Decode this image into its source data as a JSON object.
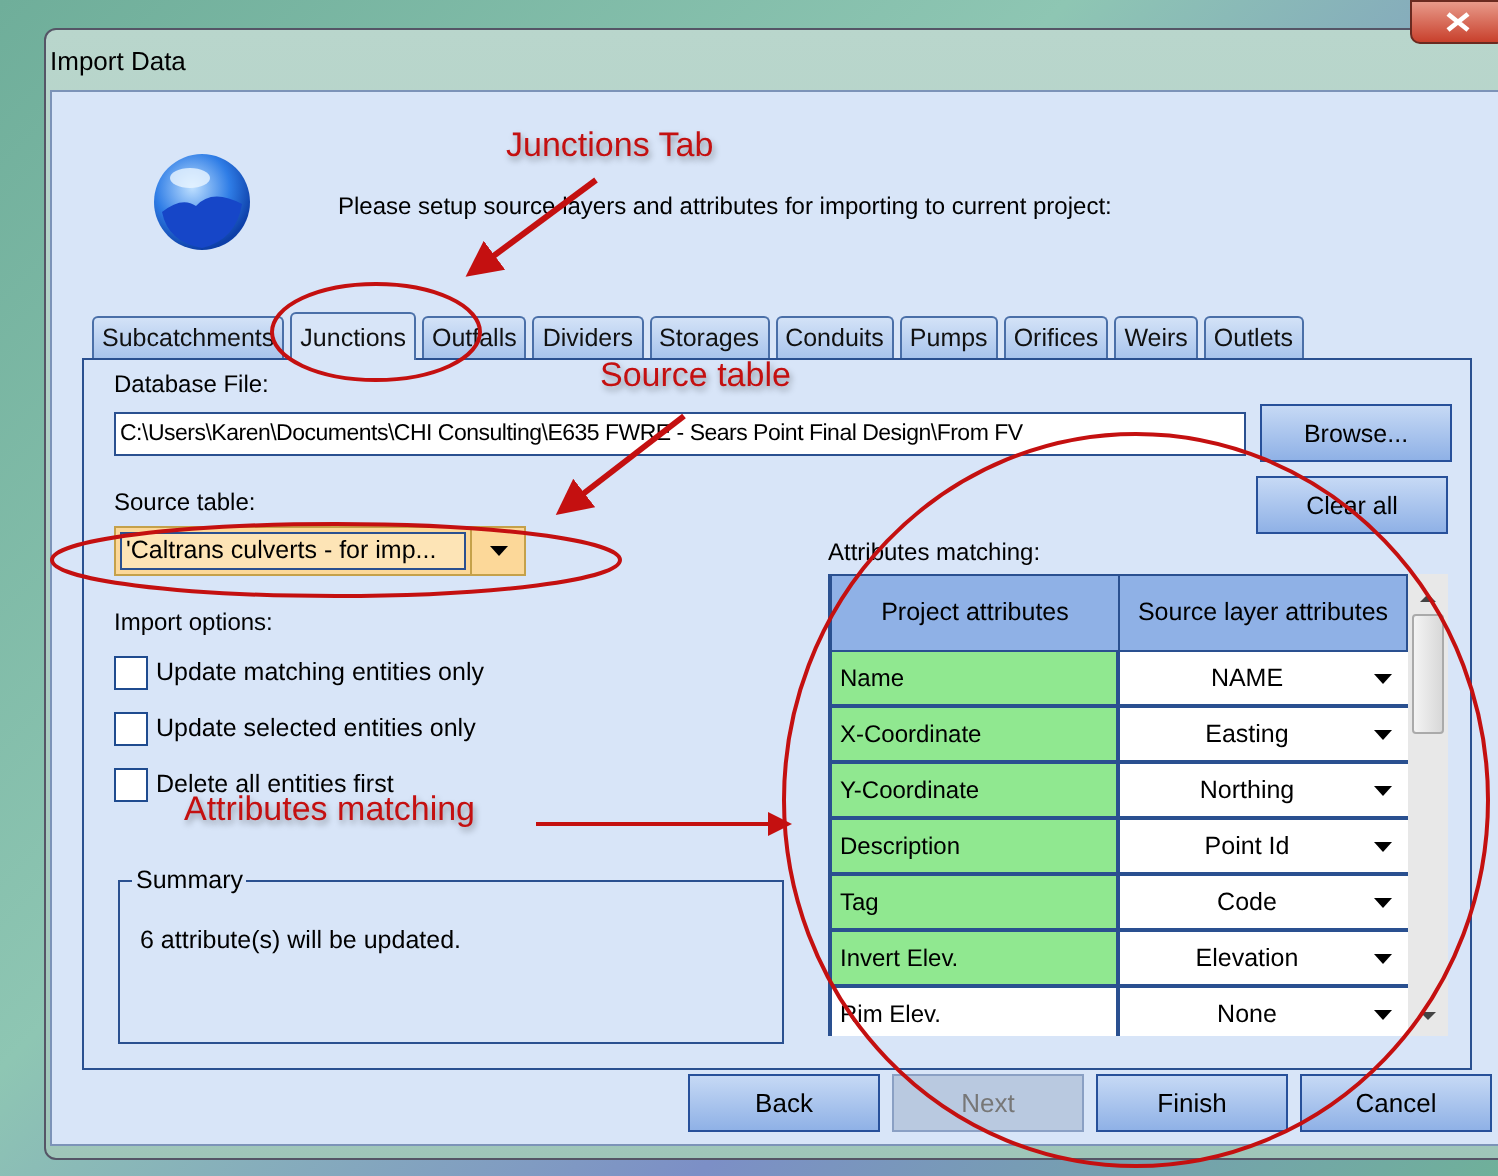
{
  "window": {
    "title": "Import Data"
  },
  "instruction": "Please setup source layers and attributes for importing to current project:",
  "tabs": [
    {
      "label": "Subcatchments",
      "selected": false
    },
    {
      "label": "Junctions",
      "selected": true
    },
    {
      "label": "Outfalls",
      "selected": false
    },
    {
      "label": "Dividers",
      "selected": false
    },
    {
      "label": "Storages",
      "selected": false
    },
    {
      "label": "Conduits",
      "selected": false
    },
    {
      "label": "Pumps",
      "selected": false
    },
    {
      "label": "Orifices",
      "selected": false
    },
    {
      "label": "Weirs",
      "selected": false
    },
    {
      "label": "Outlets",
      "selected": false
    }
  ],
  "database_file": {
    "label": "Database File:",
    "value": "C:\\Users\\Karen\\Documents\\CHI Consulting\\E635 FWRE - Sears Point Final Design\\From FV"
  },
  "browse_button": "Browse...",
  "source_table": {
    "label": "Source table:",
    "value": "'Caltrans culverts - for imp..."
  },
  "clear_button": "Clear all",
  "import_options": {
    "label": "Import options:",
    "options": [
      {
        "label": "Update matching entities only",
        "checked": false
      },
      {
        "label": "Update selected entities only",
        "checked": false
      },
      {
        "label": "Delete all entities first",
        "checked": false
      }
    ]
  },
  "summary": {
    "title": "Summary",
    "text": "6 attribute(s) will be updated."
  },
  "attributes": {
    "label": "Attributes matching:",
    "columns": [
      "Project attributes",
      "Source layer attributes"
    ],
    "rows": [
      {
        "project": "Name",
        "source": "NAME",
        "matched": true
      },
      {
        "project": "X-Coordinate",
        "source": "Easting",
        "matched": true
      },
      {
        "project": "Y-Coordinate",
        "source": "Northing",
        "matched": true
      },
      {
        "project": "Description",
        "source": "Point Id",
        "matched": true
      },
      {
        "project": "Tag",
        "source": "Code",
        "matched": true
      },
      {
        "project": "Invert Elev.",
        "source": "Elevation",
        "matched": true
      },
      {
        "project": "Rim Elev.",
        "source": "None",
        "matched": false
      }
    ]
  },
  "buttons": [
    {
      "label": "Back",
      "disabled": false
    },
    {
      "label": "Next",
      "disabled": true
    },
    {
      "label": "Finish",
      "disabled": false
    },
    {
      "label": "Cancel",
      "disabled": false
    }
  ],
  "annotations": [
    {
      "text": "Junctions Tab"
    },
    {
      "text": "Source table"
    },
    {
      "text": "Attributes matching"
    }
  ]
}
